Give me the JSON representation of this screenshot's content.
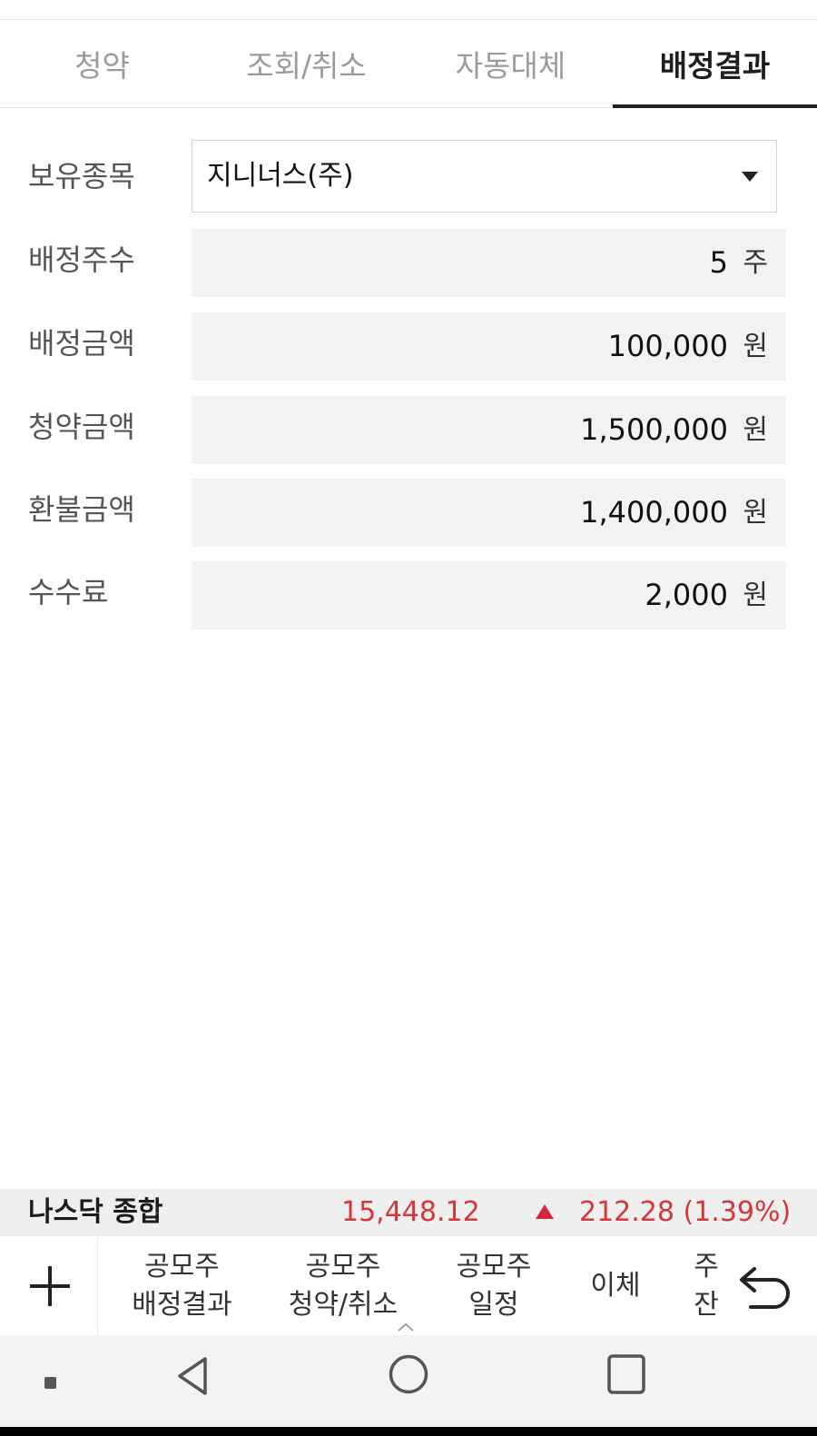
{
  "tabs": [
    {
      "label": "청약"
    },
    {
      "label": "조회/취소"
    },
    {
      "label": "자동대체"
    },
    {
      "label": "배정결과"
    }
  ],
  "form": {
    "holding": {
      "label": "보유종목",
      "value": "지니너스(주)"
    },
    "allotted_shares": {
      "label": "배정주수",
      "value": "5",
      "unit": "주"
    },
    "allotted_amount": {
      "label": "배정금액",
      "value": "100,000",
      "unit": "원"
    },
    "subscription_amount": {
      "label": "청약금액",
      "value": "1,500,000",
      "unit": "원"
    },
    "refund_amount": {
      "label": "환불금액",
      "value": "1,400,000",
      "unit": "원"
    },
    "fee": {
      "label": "수수료",
      "value": "2,000",
      "unit": "원"
    }
  },
  "ticker": {
    "name": "나스닥 종합",
    "price": "15,448.12",
    "change": "212.28 (1.39%)"
  },
  "menu": {
    "items": [
      {
        "line1": "공모주",
        "line2": "배정결과"
      },
      {
        "line1": "공모주",
        "line2": "청약/취소"
      },
      {
        "line1": "공모주",
        "line2": "일정"
      },
      {
        "line1": "이체",
        "line2": ""
      },
      {
        "line1": "주",
        "line2": "잔"
      }
    ]
  },
  "icons": {
    "plus": "plus-icon",
    "back": "undo-arrow-icon",
    "nav_back": "triangle-back-icon",
    "nav_home": "circle-home-icon",
    "nav_recent": "square-recent-icon"
  },
  "colors": {
    "up": "#d53636",
    "active_tab": "#1e1e1e",
    "inactive_tab": "#9b9b9b",
    "field_bg": "#f2f2f2"
  }
}
